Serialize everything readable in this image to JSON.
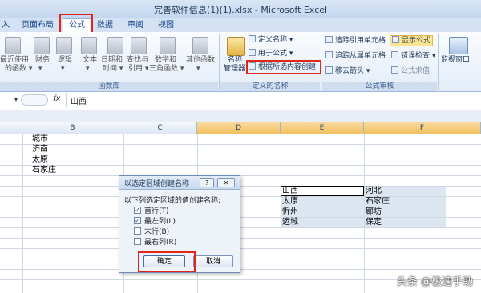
{
  "window": {
    "title": "完善软件信息(1)(1).xlsx - Microsoft Excel"
  },
  "tabs": [
    {
      "label": "入"
    },
    {
      "label": "页面布局"
    },
    {
      "label": "公式"
    },
    {
      "label": "数据"
    },
    {
      "label": "审阅"
    },
    {
      "label": "视图"
    }
  ],
  "ribbon": {
    "library": {
      "group_label": "函数库",
      "items": [
        {
          "line1": "最近使用",
          "line2": "的函数 ▾"
        },
        {
          "line1": "财务",
          "line2": "▾"
        },
        {
          "line1": "逻辑",
          "line2": "▾"
        },
        {
          "line1": "文本",
          "line2": "▾"
        },
        {
          "line1": "日期和",
          "line2": "时间 ▾"
        },
        {
          "line1": "查找与",
          "line2": "引用 ▾"
        },
        {
          "line1": "数学和",
          "line2": "三角函数 ▾"
        },
        {
          "line1": "其他函数",
          "line2": "▾"
        }
      ]
    },
    "names": {
      "group_label": "定义的名称",
      "manager_line1": "名称",
      "manager_line2": "管理器",
      "define_name": "定义名称 ▾",
      "use_in_formula": "用于公式 ▾",
      "create_from_selection": "根据所选内容创建"
    },
    "audit": {
      "group_label": "公式审核",
      "trace_precedents": "追踪引用单元格",
      "trace_dependents": "追踪从属单元格",
      "remove_arrows": "移去箭头 ▾",
      "show_formulas": "显示公式",
      "error_checking": "错误检查 ▾",
      "evaluate_formula": "公式求值",
      "watch_window": "监视窗口"
    }
  },
  "formula_bar": {
    "name_box": "",
    "fx": "fx",
    "value": "山西"
  },
  "columns": [
    "B",
    "C",
    "D",
    "E",
    "F"
  ],
  "cells": {
    "b1": "城市",
    "b2": "济南",
    "b3": "太原",
    "b4": "石家庄",
    "e1": "山西",
    "f1": "河北",
    "e2": "太原",
    "f2": "石家庄",
    "e3": "忻州",
    "f3": "廊坊",
    "e4": "运城",
    "f4": "保定"
  },
  "dialog": {
    "title": "以选定区域创建名称",
    "help": "?",
    "close": "✕",
    "prompt": "以下列选定区域的值创建名称:",
    "options": [
      {
        "label": "首行(T)",
        "checked": true
      },
      {
        "label": "最左列(L)",
        "checked": true
      },
      {
        "label": "末行(B)",
        "checked": false
      },
      {
        "label": "最右列(R)",
        "checked": false
      }
    ],
    "ok": "确定",
    "cancel": "取消"
  },
  "watermark": "头条 @极速手助",
  "colors": {
    "accent_red": "#e0251b",
    "selection_fill": "#dce6f1",
    "ribbon_blue": "#d4e2f3"
  }
}
